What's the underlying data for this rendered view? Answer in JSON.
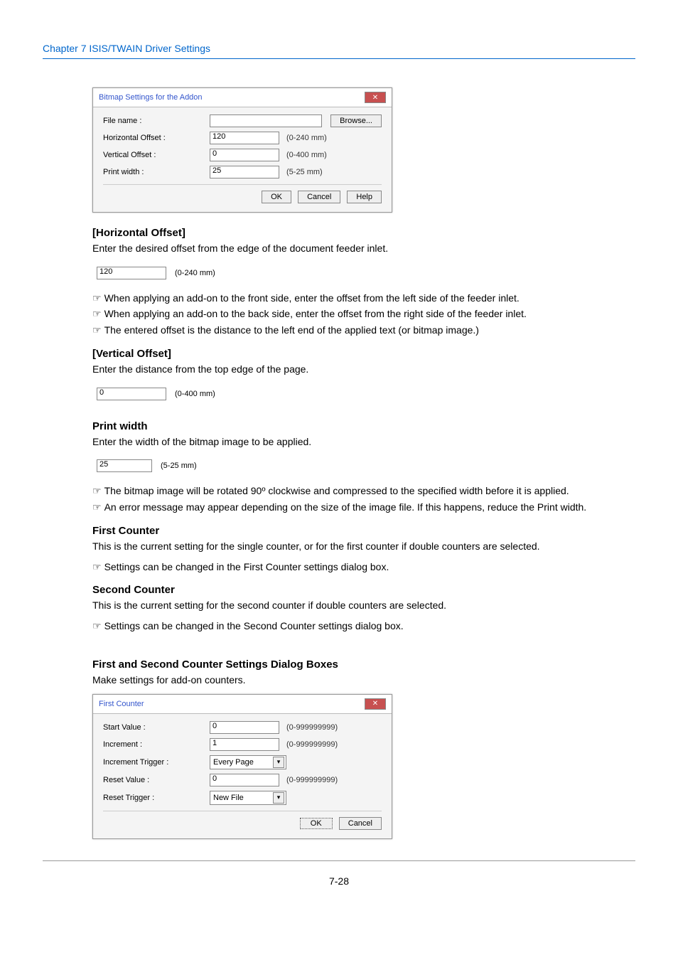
{
  "chapter_breadcrumb": "Chapter 7   ISIS/TWAIN Driver Settings",
  "dialog1": {
    "title": "Bitmap Settings for the Addon",
    "rows": {
      "filename": {
        "label": "File name :",
        "btn": "Browse..."
      },
      "horiz": {
        "label": "Horizontal Offset :",
        "value": "120",
        "range": "(0-240 mm)"
      },
      "vert": {
        "label": "Vertical Offset :",
        "value": "0",
        "range": "(0-400 mm)"
      },
      "printw": {
        "label": "Print width :",
        "value": "25",
        "range": "(5-25 mm)"
      }
    },
    "buttons": {
      "ok": "OK",
      "cancel": "Cancel",
      "help": "Help"
    }
  },
  "s_horiz": {
    "heading": "[Horizontal Offset]",
    "text": "Enter the desired offset from the edge of the document feeder inlet.",
    "field_value": "120",
    "field_range": "(0-240 mm)",
    "notes": [
      "When applying an add-on to the front side, enter the offset from the left side of the feeder inlet.",
      "When applying an add-on to the back side, enter the offset from the right side of the feeder inlet.",
      "The entered offset is the distance to the left end of the applied text (or bitmap image.)"
    ]
  },
  "s_vert": {
    "heading": "[Vertical Offset]",
    "text": "Enter the distance from the top edge of the page.",
    "field_value": "0",
    "field_range": "(0-400 mm)"
  },
  "s_printw": {
    "heading": "Print width",
    "text": "Enter the width of the bitmap image to be applied.",
    "field_value": "25",
    "field_range": "(5-25 mm)",
    "note1": "The bitmap image will be rotated 90º clockwise and compressed to the specified width before it is applied.",
    "note2": "An error message may appear depending on the size of the image file. If this happens, reduce the Print width."
  },
  "s_first": {
    "heading": "First Counter",
    "text": "This is the current setting for the single counter, or for the first counter if double counters are selected.",
    "note": "Settings can be changed in the First Counter settings dialog box."
  },
  "s_second": {
    "heading": "Second Counter",
    "text": "This is the current setting for the second counter if double counters are selected.",
    "note": "Settings can be changed in the Second Counter settings dialog box."
  },
  "s_counters": {
    "heading": "First and Second Counter Settings Dialog Boxes",
    "text": "Make settings for add-on counters."
  },
  "dialog2": {
    "title": "First Counter",
    "rows": {
      "start": {
        "label": "Start Value :",
        "value": "0",
        "range": "(0-999999999)"
      },
      "increment": {
        "label": "Increment :",
        "value": "1",
        "range": "(0-999999999)"
      },
      "inctrig": {
        "label": "Increment Trigger :",
        "value": "Every Page"
      },
      "resetval": {
        "label": "Reset Value :",
        "value": "0",
        "range": "(0-999999999)"
      },
      "resettrig": {
        "label": "Reset Trigger :",
        "value": "New File"
      }
    },
    "buttons": {
      "ok": "OK",
      "cancel": "Cancel"
    }
  },
  "page_number": "7-28",
  "hand": "☞"
}
